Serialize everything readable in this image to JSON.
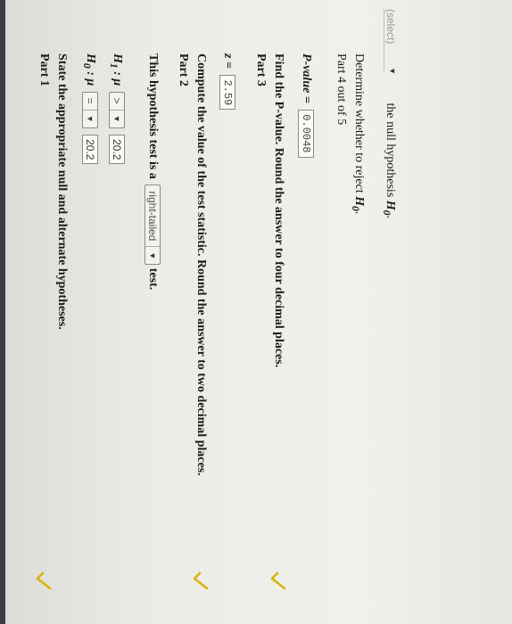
{
  "part1": {
    "label": "Part 1",
    "instruction": "State the appropriate null and alternate hypotheses.",
    "h0_label": "H",
    "h0_sub": "0",
    "mu": ": μ",
    "h0_operator": "=",
    "h0_value": "20.2",
    "h1_label": "H",
    "h1_sub": "1",
    "h1_operator": ">",
    "h1_value": "20.2",
    "test_prefix": "This hypothesis test is a",
    "test_type": "right-tailed",
    "test_suffix": "test."
  },
  "part2": {
    "label": "Part 2",
    "instruction": "Compute the value of the test statistic. Round the answer to two decimal places.",
    "z_label": "z =",
    "z_value": "2.59"
  },
  "part3": {
    "label": "Part 3",
    "instruction": "Find the P-value. Round the answer to four decimal places.",
    "p_label": "P-value =",
    "p_value": "0.0048"
  },
  "part4": {
    "label": "Part 4 out of 5",
    "instruction_prefix": "Determine whether to reject",
    "instruction_var": "H",
    "instruction_sub": "0",
    "select_placeholder": "(select)",
    "suffix": "the null hypothesis",
    "suffix_var": "H",
    "suffix_sub": "0"
  },
  "colors": {
    "check": "#d6b400",
    "page": "#f1f1ec"
  },
  "icons": [
    "checkmark-icon",
    "chevron-down-icon"
  ]
}
